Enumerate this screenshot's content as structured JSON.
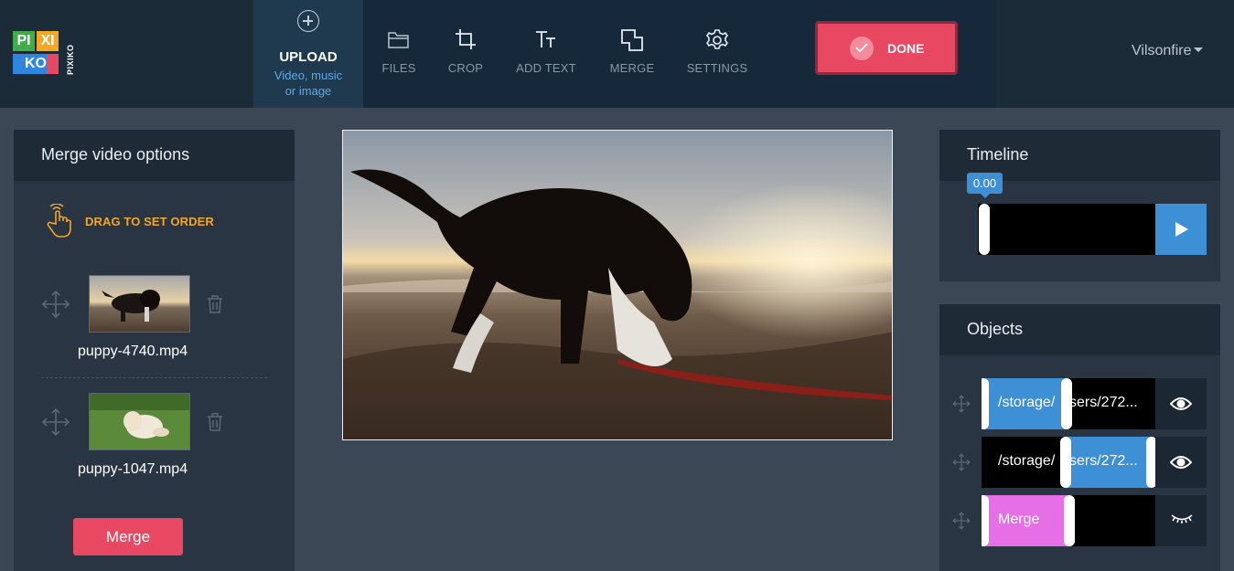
{
  "header": {
    "logo_letters": [
      "PI",
      "XI",
      "KO"
    ],
    "logo_vertical": "PIXIKO",
    "upload": {
      "title": "UPLOAD",
      "subtitle_line1": "Video, music",
      "subtitle_line2": "or image"
    },
    "nav": [
      {
        "id": "files",
        "label": "FILES",
        "icon": "folder-icon"
      },
      {
        "id": "crop",
        "label": "CROP",
        "icon": "crop-icon"
      },
      {
        "id": "add_text",
        "label": "ADD TEXT",
        "icon": "text-icon"
      },
      {
        "id": "merge",
        "label": "MERGE",
        "icon": "merge-icon"
      },
      {
        "id": "settings",
        "label": "SETTINGS",
        "icon": "gear-icon"
      }
    ],
    "done_label": "DONE",
    "user_name": "Vilsonfire"
  },
  "left_panel": {
    "title": "Merge video options",
    "drag_hint": "DRAG TO SET ORDER",
    "items": [
      {
        "filename": "puppy-4740.mp4"
      },
      {
        "filename": "puppy-1047.mp4"
      }
    ],
    "merge_button": "Merge"
  },
  "timeline": {
    "title": "Timeline",
    "value": "0.00"
  },
  "objects": {
    "title": "Objects",
    "rows": [
      {
        "text_left": "/storage/",
        "text_right": "sers/272...",
        "visible": true
      },
      {
        "text_left": "/storage/",
        "text_right": "sers/272...",
        "visible": true
      },
      {
        "text_left": "Merge",
        "visible": false
      }
    ]
  },
  "colors": {
    "accent_red": "#e84862",
    "accent_blue": "#3d8fd6",
    "drag_hint_orange": "#f5a623",
    "merge_segment_magenta": "#e66ee6"
  }
}
